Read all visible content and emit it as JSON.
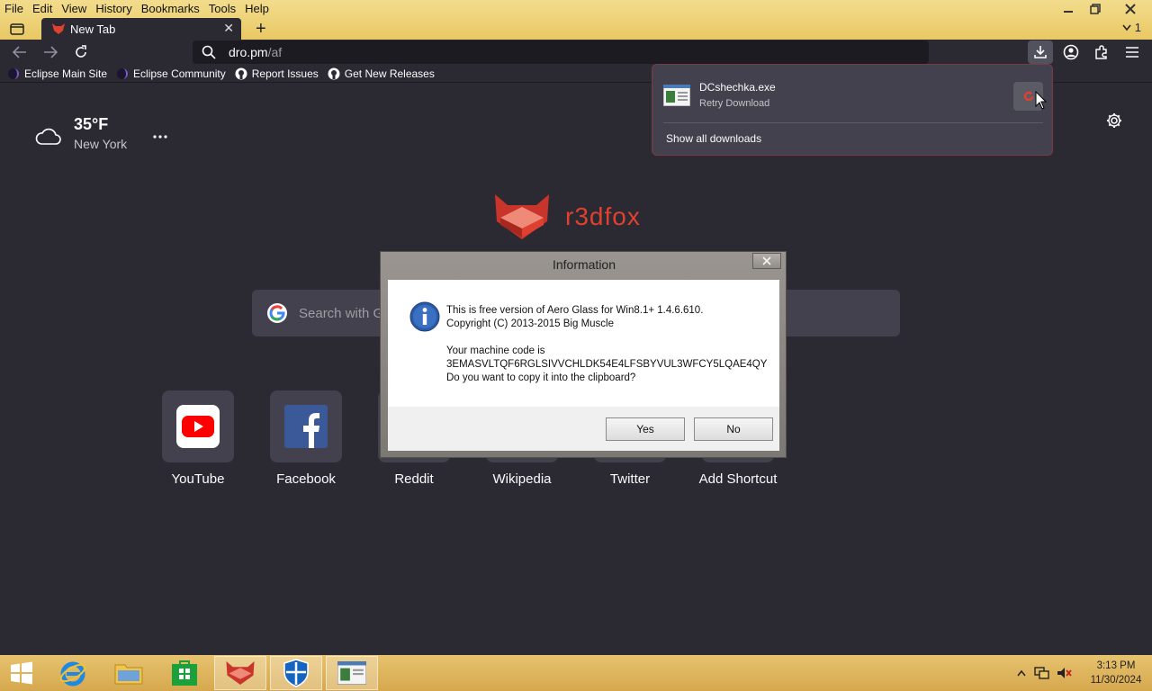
{
  "browser": {
    "menu": [
      {
        "label": "File"
      },
      {
        "label": "Edit"
      },
      {
        "label": "View"
      },
      {
        "label": "History"
      },
      {
        "label": "Bookmarks"
      },
      {
        "label": "Tools"
      },
      {
        "label": "Help"
      }
    ],
    "tab": {
      "title": "New Tab"
    },
    "tabs_overflow_count": "1",
    "url": {
      "host": "dro.pm",
      "path": "/af"
    },
    "bookmarks": [
      {
        "label": "Eclipse Main Site",
        "icon": "eclipse-icon"
      },
      {
        "label": "Eclipse Community",
        "icon": "eclipse-icon"
      },
      {
        "label": "Report Issues",
        "icon": "github-icon"
      },
      {
        "label": "Get New Releases",
        "icon": "github-icon"
      }
    ]
  },
  "newtab": {
    "weather": {
      "temp": "35°F",
      "city": "New York",
      "icon": "cloud-icon"
    },
    "brand": "r3dfox",
    "search_placeholder": "Search with G",
    "shortcuts": [
      {
        "label": "YouTube"
      },
      {
        "label": "Facebook"
      },
      {
        "label": "Reddit"
      },
      {
        "label": "Wikipedia"
      },
      {
        "label": "Twitter"
      },
      {
        "label": "Add Shortcut"
      }
    ]
  },
  "downloads_panel": {
    "filename": "DCshechka.exe",
    "status": "Retry Download",
    "show_all": "Show all downloads"
  },
  "dialog": {
    "title": "Information",
    "line1": "This is free version of Aero Glass for Win8.1+ 1.4.6.610.",
    "line2": "Copyright (C) 2013-2015 Big Muscle",
    "line3": "Your machine code is",
    "line4": "3EMASVLTQF6RGLSIVVCHLDK54E4LFSBYVUL3WFCY5LQAE4QY",
    "line5": "Do you want to copy it into the clipboard?",
    "yes": "Yes",
    "no": "No"
  },
  "taskbar": {
    "time": "3:13 PM",
    "date": "11/30/2024"
  },
  "colors": {
    "accent": "#e0402f",
    "bg": "#2b2a33",
    "taskbar": "#d6a84e"
  }
}
